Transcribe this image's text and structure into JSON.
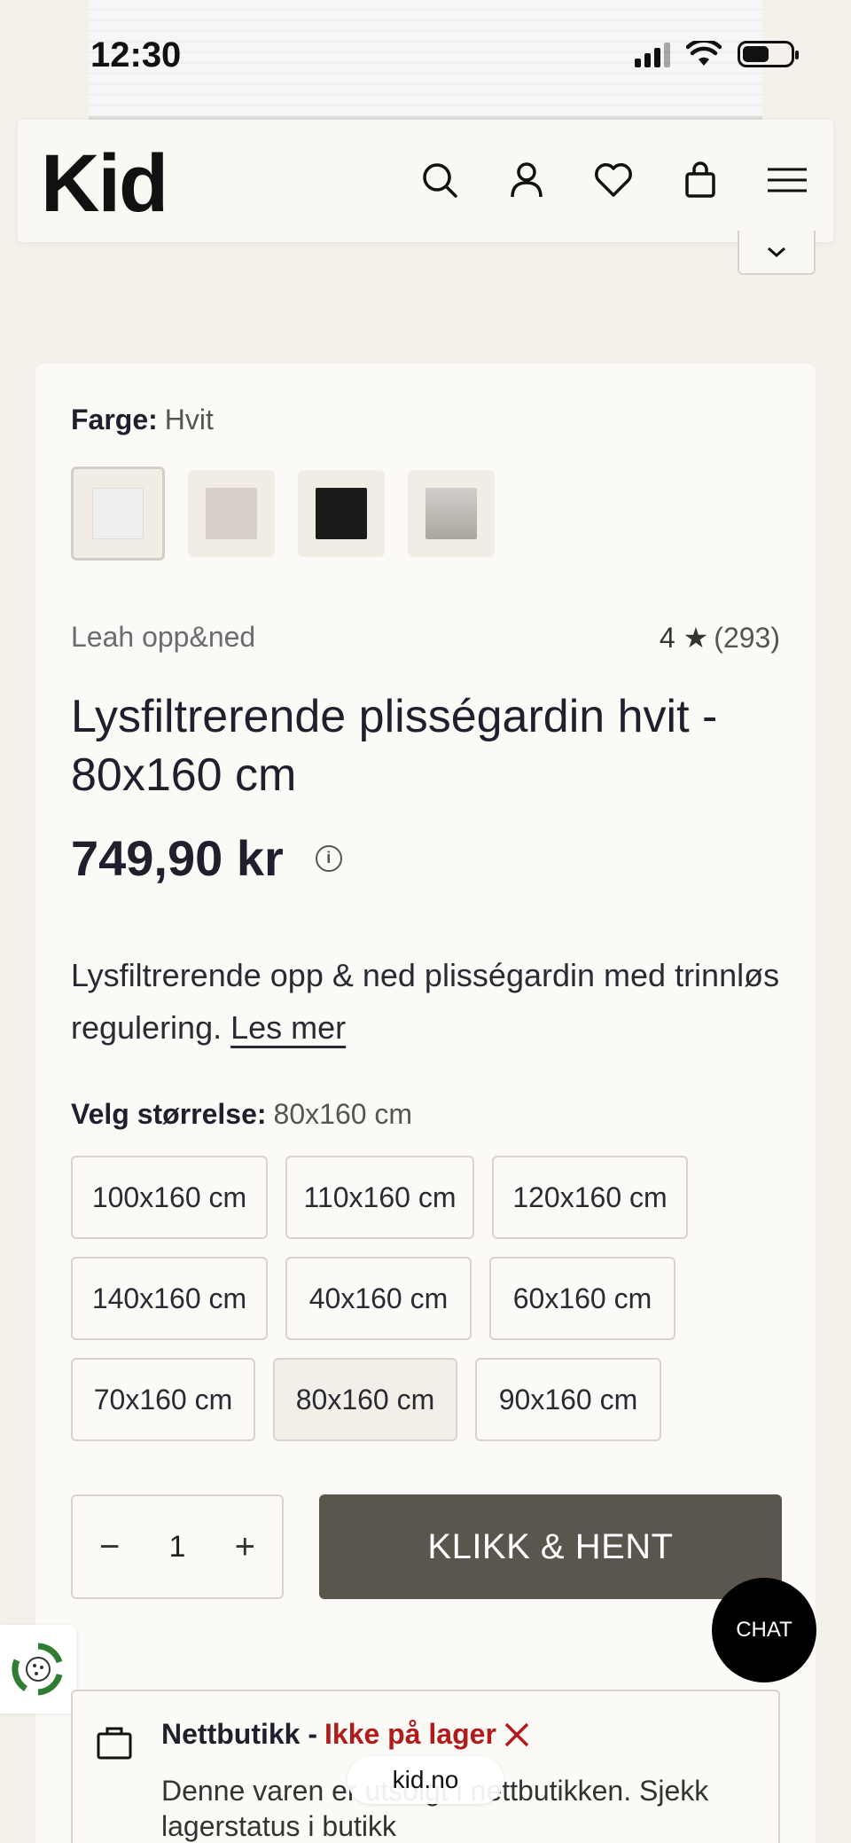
{
  "status_bar": {
    "time": "12:30"
  },
  "header": {
    "logo": "Kid",
    "icons": [
      "search-icon",
      "user-icon",
      "heart-icon",
      "bag-icon",
      "menu-icon"
    ]
  },
  "product": {
    "color_label": "Farge:",
    "color_value": "Hvit",
    "swatches": [
      {
        "name": "Hvit",
        "color": "#eeeeee",
        "selected": true
      },
      {
        "name": "Beige",
        "color": "#d8d0c8"
      },
      {
        "name": "Svart",
        "color": "#1b1b1b"
      },
      {
        "name": "Grå",
        "color": "#c4c1bb"
      }
    ],
    "brand": "Leah opp&ned",
    "rating": "4",
    "rating_count": "(293)",
    "title": "Lysfiltrerende plisségardin hvit - 80x160 cm",
    "price": "749,90 kr",
    "description": "Lysfiltrerende opp & ned plisségardin med trinnløs regulering.",
    "read_more": "Les mer",
    "size_label": "Velg størrelse:",
    "size_value": "80x160 cm",
    "sizes": [
      "100x160 cm",
      "110x160 cm",
      "120x160 cm",
      "140x160 cm",
      "40x160 cm",
      "60x160 cm",
      "70x160 cm",
      "80x160 cm",
      "90x160 cm"
    ],
    "selected_size": "80x160 cm",
    "quantity": "1",
    "cta": "KLIKK & HENT"
  },
  "chat": {
    "label": "CHAT"
  },
  "stock": {
    "channel": "Nettbutikk -",
    "status": "Ikke på lager",
    "text": "Denne varen er utsolgt i nettbutikken. Sjekk lagerstatus i butikk"
  },
  "browser": {
    "url": "kid.no"
  },
  "colors": {
    "cta": "#5a554d",
    "out_of_stock": "#b01b1b",
    "background": "#f4f0ea"
  }
}
